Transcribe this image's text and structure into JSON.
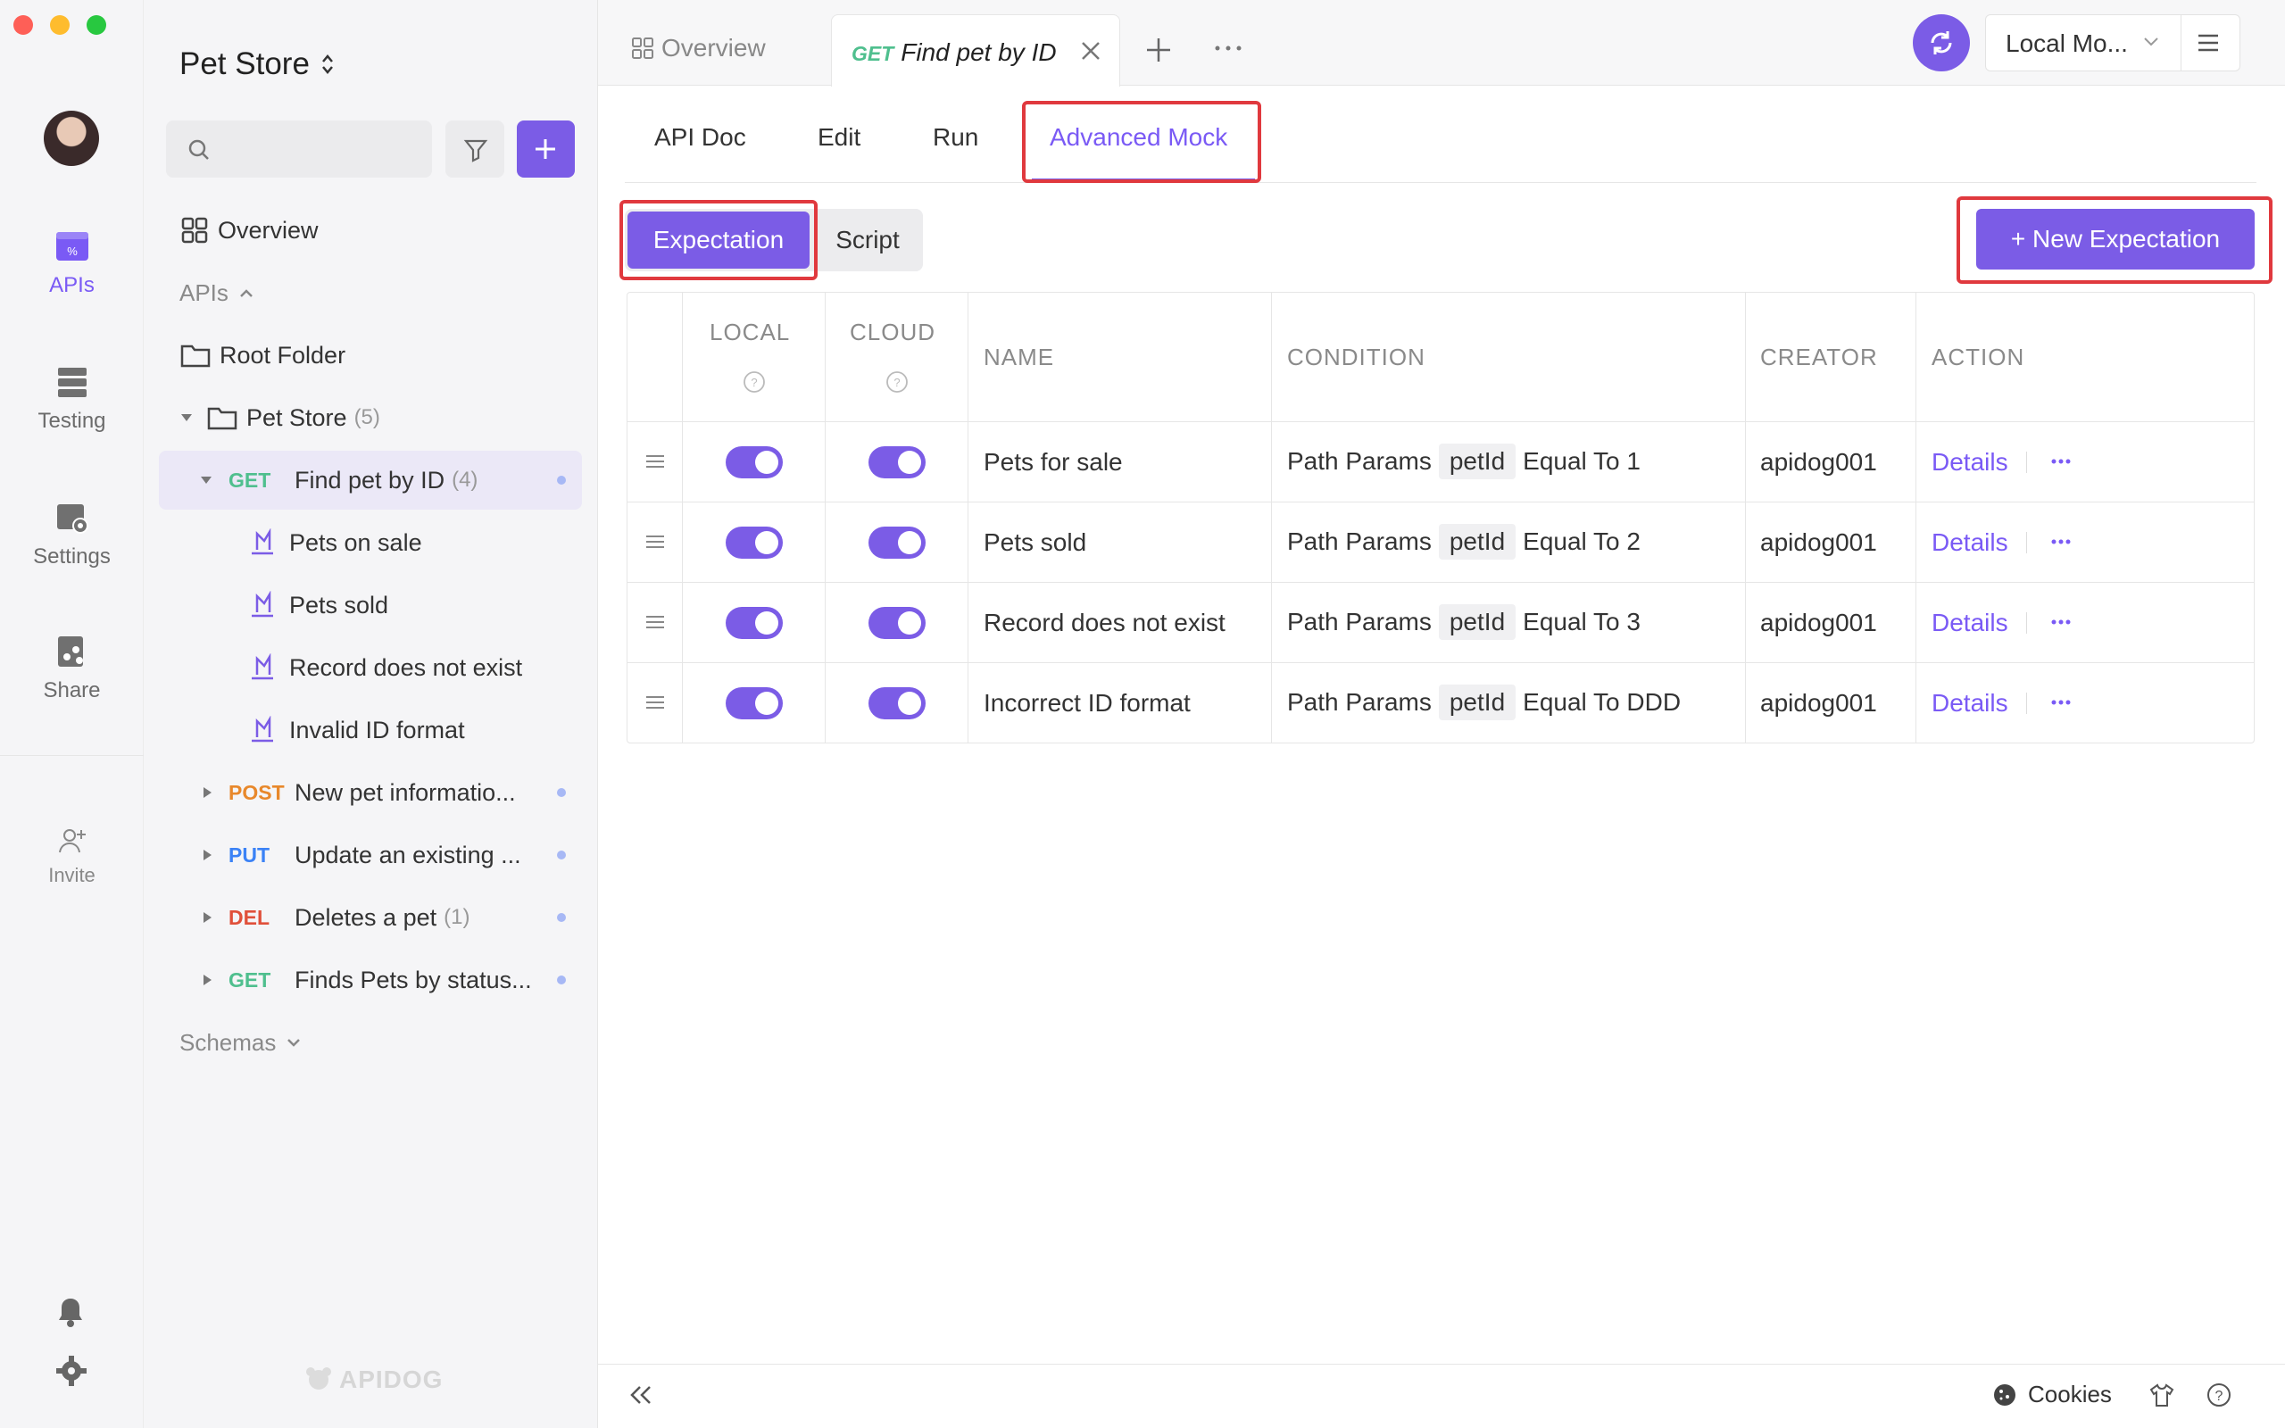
{
  "rail": {
    "items": [
      {
        "label": "APIs",
        "icon": "apis-icon"
      },
      {
        "label": "Testing",
        "icon": "testing-icon"
      },
      {
        "label": "Settings",
        "icon": "settings-icon"
      },
      {
        "label": "Share",
        "icon": "share-icon"
      },
      {
        "label": "Invite",
        "icon": "invite-icon"
      }
    ]
  },
  "sidebar": {
    "project": "Pet Store",
    "overview": "Overview",
    "apis_label": "APIs",
    "root_folder": "Root Folder",
    "folder": {
      "name": "Pet Store",
      "count": "(5)"
    },
    "endpoint_selected": {
      "method": "GET",
      "name": "Find pet by ID",
      "count": "(4)"
    },
    "expectations": [
      "Pets on sale",
      "Pets sold",
      "Record does not exist",
      "Invalid ID format"
    ],
    "endpoints": [
      {
        "method": "POST",
        "name": "New pet informatio..."
      },
      {
        "method": "PUT",
        "name": "Update an existing ..."
      },
      {
        "method": "DEL",
        "name": "Deletes a pet",
        "count": "(1)"
      },
      {
        "method": "GET",
        "name": "Finds Pets by status..."
      }
    ],
    "schemas": "Schemas",
    "brand": "APIDOG"
  },
  "tabs": {
    "overview": "Overview",
    "active_method": "GET",
    "active_name": "Find pet by ID",
    "env": "Local Mo..."
  },
  "subtabs": [
    "API Doc",
    "Edit",
    "Run",
    "Advanced Mock"
  ],
  "toggle_buttons": {
    "expectation": "Expectation",
    "script": "Script"
  },
  "new_expectation": "+ New Expectation",
  "table": {
    "headers": {
      "local": "LOCAL",
      "cloud": "CLOUD",
      "name": "NAME",
      "condition": "CONDITION",
      "creator": "CREATOR",
      "action": "ACTION"
    },
    "rows": [
      {
        "name": "Pets for sale",
        "cond_prefix": "Path Params",
        "param": "petId",
        "cond": "Equal To 1",
        "creator": "apidog001",
        "action": "Details",
        "local_on": true,
        "cloud_on": true
      },
      {
        "name": "Pets sold",
        "cond_prefix": "Path Params",
        "param": "petId",
        "cond": "Equal To 2",
        "creator": "apidog001",
        "action": "Details",
        "local_on": true,
        "cloud_on": true
      },
      {
        "name": "Record does not exist",
        "cond_prefix": "Path Params",
        "param": "petId",
        "cond": "Equal To 3",
        "creator": "apidog001",
        "action": "Details",
        "local_on": true,
        "cloud_on": true
      },
      {
        "name": "Incorrect ID format",
        "cond_prefix": "Path Params",
        "param": "petId",
        "cond": "Equal To DDD",
        "creator": "apidog001",
        "action": "Details",
        "local_on": true,
        "cloud_on": true
      }
    ]
  },
  "footer": {
    "cookies": "Cookies"
  },
  "colors": {
    "accent": "#7b5ce6",
    "get": "#4fbf8e",
    "post": "#e8882b",
    "put": "#3b82f6",
    "del": "#e0503a",
    "highlight": "#e0393e"
  }
}
